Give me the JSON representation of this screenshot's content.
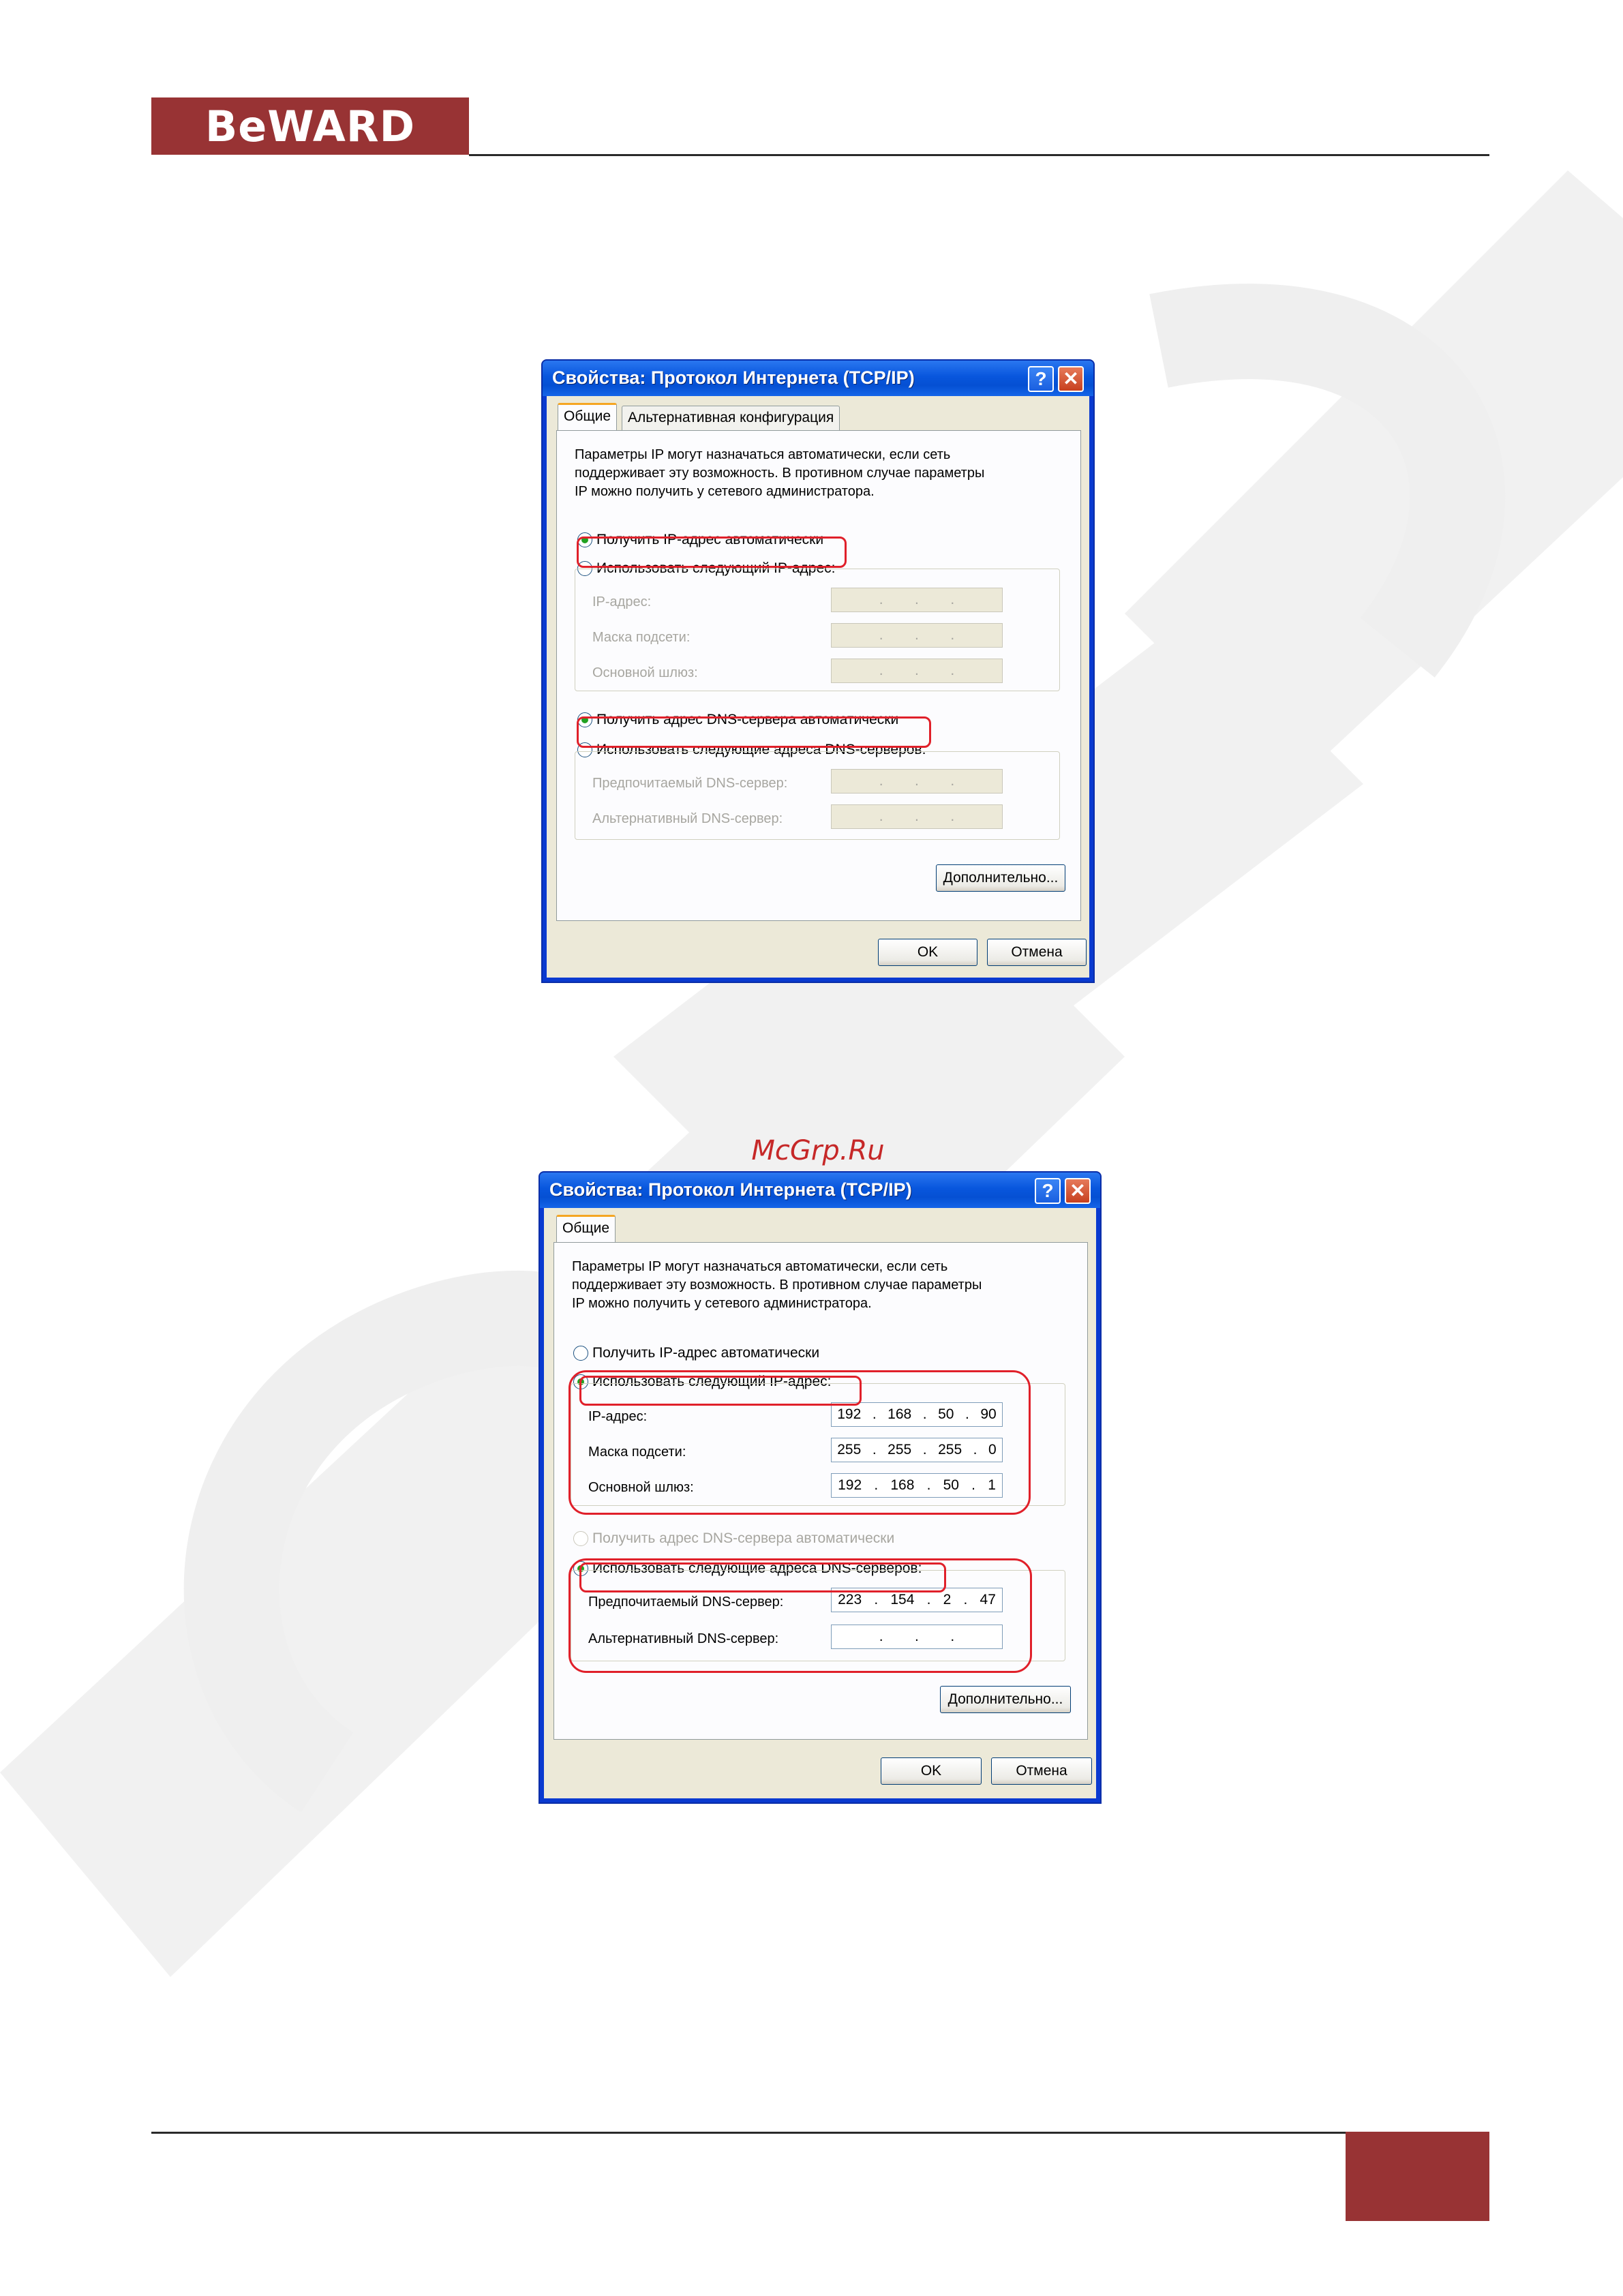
{
  "header": {
    "logo_text": "BeWARD"
  },
  "source_label": "McGrp.Ru",
  "dialog1": {
    "title": "Свойства: Протокол Интернета (TCP/IP)",
    "help_button": "?",
    "close_button": "✕",
    "tabs": [
      "Общие",
      "Альтернативная конфигурация"
    ],
    "description": [
      "Параметры IP могут назначаться автоматически, если сеть",
      "поддерживает эту возможность. В противном случае параметры",
      "IP можно получить у сетевого администратора."
    ],
    "radio_ip_auto": "Получить IP-адрес автоматически",
    "radio_ip_manual": "Использовать следующий IP-адрес:",
    "label_ip": "IP-адрес:",
    "label_mask": "Маска подсети:",
    "label_gateway": "Основной шлюз:",
    "radio_dns_auto": "Получить адрес DNS-сервера автоматически",
    "radio_dns_manual": "Использовать следующие адреса DNS-серверов:",
    "label_dns_pref": "Предпочитаемый DNS-сервер:",
    "label_dns_alt": "Альтернативный DNS-сервер:",
    "advanced_button": "Дополнительно...",
    "ok_button": "OK",
    "cancel_button": "Отмена",
    "dot": "."
  },
  "dialog2": {
    "title": "Свойства: Протокол Интернета (TCP/IP)",
    "help_button": "?",
    "close_button": "✕",
    "tabs": [
      "Общие"
    ],
    "description": [
      "Параметры IP могут назначаться автоматически, если сеть",
      "поддерживает эту возможность. В противном случае параметры",
      "IP можно получить у сетевого администратора."
    ],
    "radio_ip_auto": "Получить IP-адрес автоматически",
    "radio_ip_manual": "Использовать следующий IP-адрес:",
    "label_ip": "IP-адрес:",
    "label_mask": "Маска подсети:",
    "label_gateway": "Основной шлюз:",
    "ip_address": [
      "192",
      "168",
      "50",
      "90"
    ],
    "subnet_mask": [
      "255",
      "255",
      "255",
      "0"
    ],
    "gateway": [
      "192",
      "168",
      "50",
      "1"
    ],
    "radio_dns_auto": "Получить адрес DNS-сервера автоматически",
    "radio_dns_manual": "Использовать следующие адреса DNS-серверов:",
    "label_dns_pref": "Предпочитаемый DNS-сервер:",
    "label_dns_alt": "Альтернативный DNS-сервер:",
    "dns_preferred": [
      "223",
      "154",
      "2",
      "47"
    ],
    "advanced_button": "Дополнительно...",
    "ok_button": "OK",
    "cancel_button": "Отмена",
    "dot": "."
  },
  "colors": {
    "brand": "#983334",
    "highlight": "#e0202a",
    "xp_title": "#0856dd"
  }
}
